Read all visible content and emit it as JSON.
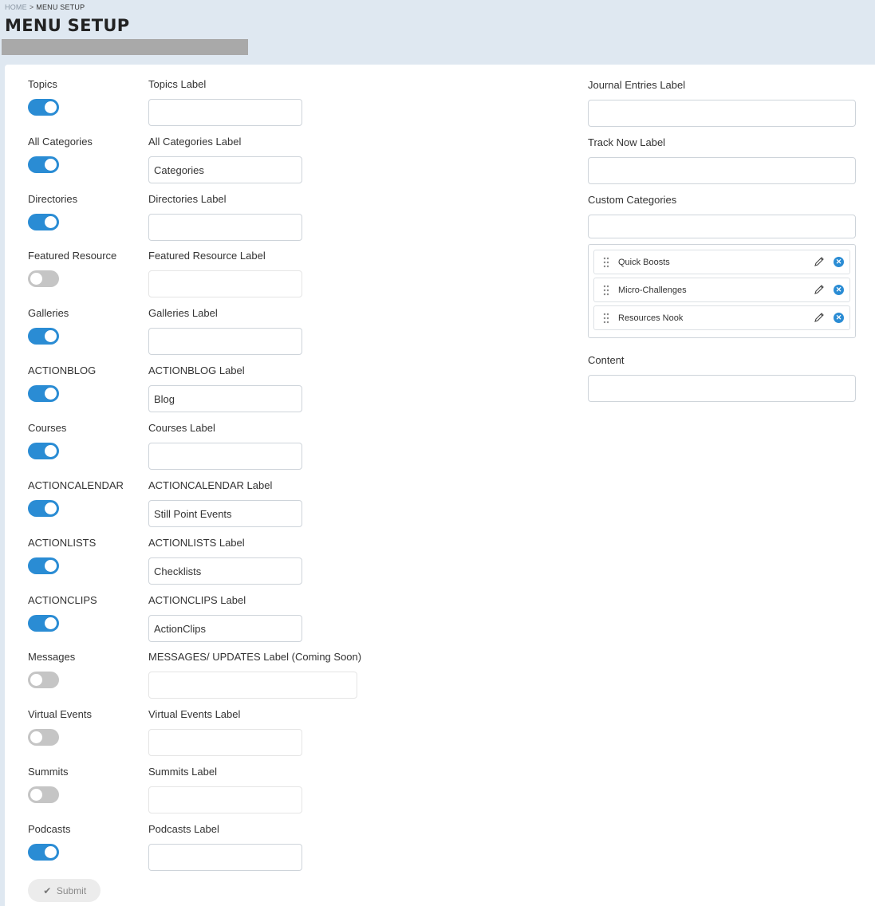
{
  "breadcrumb": {
    "home": "HOME",
    "separator": ">",
    "current": "MENU SETUP"
  },
  "page_title": "MENU SETUP",
  "colors": {
    "accent": "#2a8cd4",
    "toggle_off": "#c5c5c5",
    "header_bg": "#dfe8f1"
  },
  "rows": [
    {
      "toggle_label": "Topics",
      "on": true,
      "field_label": "Topics Label",
      "value": ""
    },
    {
      "toggle_label": "All Categories",
      "on": true,
      "field_label": "All Categories Label",
      "value": "Categories"
    },
    {
      "toggle_label": "Directories",
      "on": true,
      "field_label": "Directories Label",
      "value": ""
    },
    {
      "toggle_label": "Featured Resource",
      "on": false,
      "field_label": "Featured Resource Label",
      "value": ""
    },
    {
      "toggle_label": "Galleries",
      "on": true,
      "field_label": "Galleries Label",
      "value": ""
    },
    {
      "toggle_label": "ACTIONBLOG",
      "on": true,
      "field_label": "ACTIONBLOG Label",
      "value": "Blog"
    },
    {
      "toggle_label": "Courses",
      "on": true,
      "field_label": "Courses Label",
      "value": ""
    },
    {
      "toggle_label": "ACTIONCALENDAR",
      "on": true,
      "field_label": "ACTIONCALENDAR Label",
      "value": "Still Point Events"
    },
    {
      "toggle_label": "ACTIONLISTS",
      "on": true,
      "field_label": "ACTIONLISTS Label",
      "value": "Checklists"
    },
    {
      "toggle_label": "ACTIONCLIPS",
      "on": true,
      "field_label": "ACTIONCLIPS Label",
      "value": "ActionClips"
    },
    {
      "toggle_label": "Messages",
      "on": false,
      "field_label": "MESSAGES/ UPDATES Label (Coming Soon)",
      "value": ""
    },
    {
      "toggle_label": "Virtual Events",
      "on": false,
      "field_label": "Virtual Events Label",
      "value": ""
    },
    {
      "toggle_label": "Summits",
      "on": false,
      "field_label": "Summits Label",
      "value": ""
    },
    {
      "toggle_label": "Podcasts",
      "on": true,
      "field_label": "Podcasts Label",
      "value": ""
    }
  ],
  "right": {
    "journal_label": "Journal Entries Label",
    "journal_value": "",
    "track_label": "Track Now Label",
    "track_value": "",
    "custom_label": "Custom Categories",
    "custom_value": "",
    "categories": [
      {
        "name": "Quick Boosts",
        "icons": [
          "drag-handle-icon",
          "pencil-icon",
          "remove-icon"
        ]
      },
      {
        "name": "Micro-Challenges",
        "icons": [
          "drag-handle-icon",
          "pencil-icon",
          "remove-icon"
        ]
      },
      {
        "name": "Resources Nook",
        "icons": [
          "drag-handle-icon",
          "pencil-icon",
          "remove-icon"
        ]
      }
    ],
    "content_label": "Content",
    "content_value": ""
  },
  "submit_label": "Submit"
}
